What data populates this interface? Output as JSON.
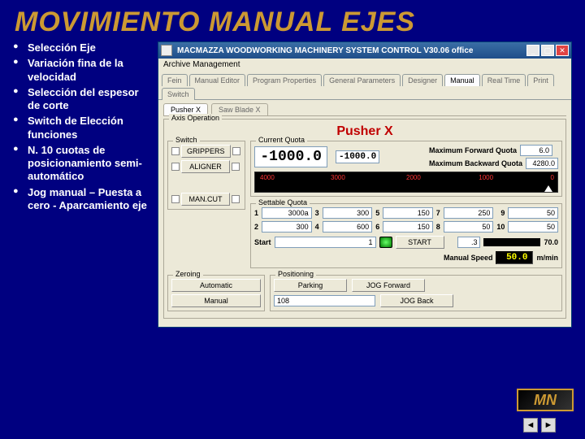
{
  "slide_title": "MOVIMIENTO MANUAL EJES",
  "bullets": [
    "Selección Eje",
    "Variación fina de la velocidad",
    "Selección del espesor de corte",
    "Switch de Elección funciones",
    "N. 10 cuotas de posicionamiento semi-automático",
    "Jog manual – Puesta a cero - Aparcamiento eje"
  ],
  "win": {
    "title": "MACMAZZA WOODWORKING MACHINERY SYSTEM CONTROL  V30.06 office",
    "menu": "Archive Management",
    "tabs": [
      "Fein",
      "Manual Editor",
      "Program Properties",
      "General Parameters",
      "Designer",
      "Manual",
      "Real Time",
      "Print",
      "Switch"
    ],
    "active_tab": "Manual",
    "subtabs": [
      "Pusher X",
      "Saw Blade X"
    ],
    "axis_op_legend": "Axis Operation",
    "axis_name": "Pusher X",
    "switch_legend": "Switch",
    "switch_btns": [
      "GRIPPERS",
      "ALIGNER",
      "MAN.CUT"
    ],
    "cur_quota_legend": "Current Quota",
    "big_quota": "-1000.0",
    "mini_quota": "-1000.0",
    "max_fwd_label": "Maximum Forward Quota",
    "max_fwd_value": "6.0",
    "max_bwd_label": "Maximum Backward Quota",
    "max_bwd_value": "4280.0",
    "ruler_ticks": [
      "4000",
      "3000",
      "2000",
      "1000",
      "0"
    ],
    "set_quota_legend": "Settable Quota",
    "quotas": [
      {
        "n": "1",
        "v": "3000a"
      },
      {
        "n": "3",
        "v": "300"
      },
      {
        "n": "5",
        "v": "150"
      },
      {
        "n": "7",
        "v": "250"
      },
      {
        "n": "9",
        "v": "50"
      },
      {
        "n": "2",
        "v": "300"
      },
      {
        "n": "4",
        "v": "600"
      },
      {
        "n": "6",
        "v": "150"
      },
      {
        "n": "8",
        "v": "50"
      },
      {
        "n": "10",
        "v": "50"
      }
    ],
    "zero_legend": "Zeroing",
    "auto_label": "Automatic",
    "manual_label": "Manual",
    "pos_legend": "Positioning",
    "parking_btn": "Parking",
    "jog_fwd_btn": "JOG Forward",
    "jog_back_btn": "JOG Back",
    "pos_value": "108",
    "start_label": "Start",
    "start_val": "1",
    "start_btn": "START",
    "stretch_val": ".3",
    "stretch_total": "70.0",
    "speed_label": "Manual Speed",
    "speed_value": "50.0",
    "speed_unit": "m/min"
  },
  "logo_text": "MN"
}
